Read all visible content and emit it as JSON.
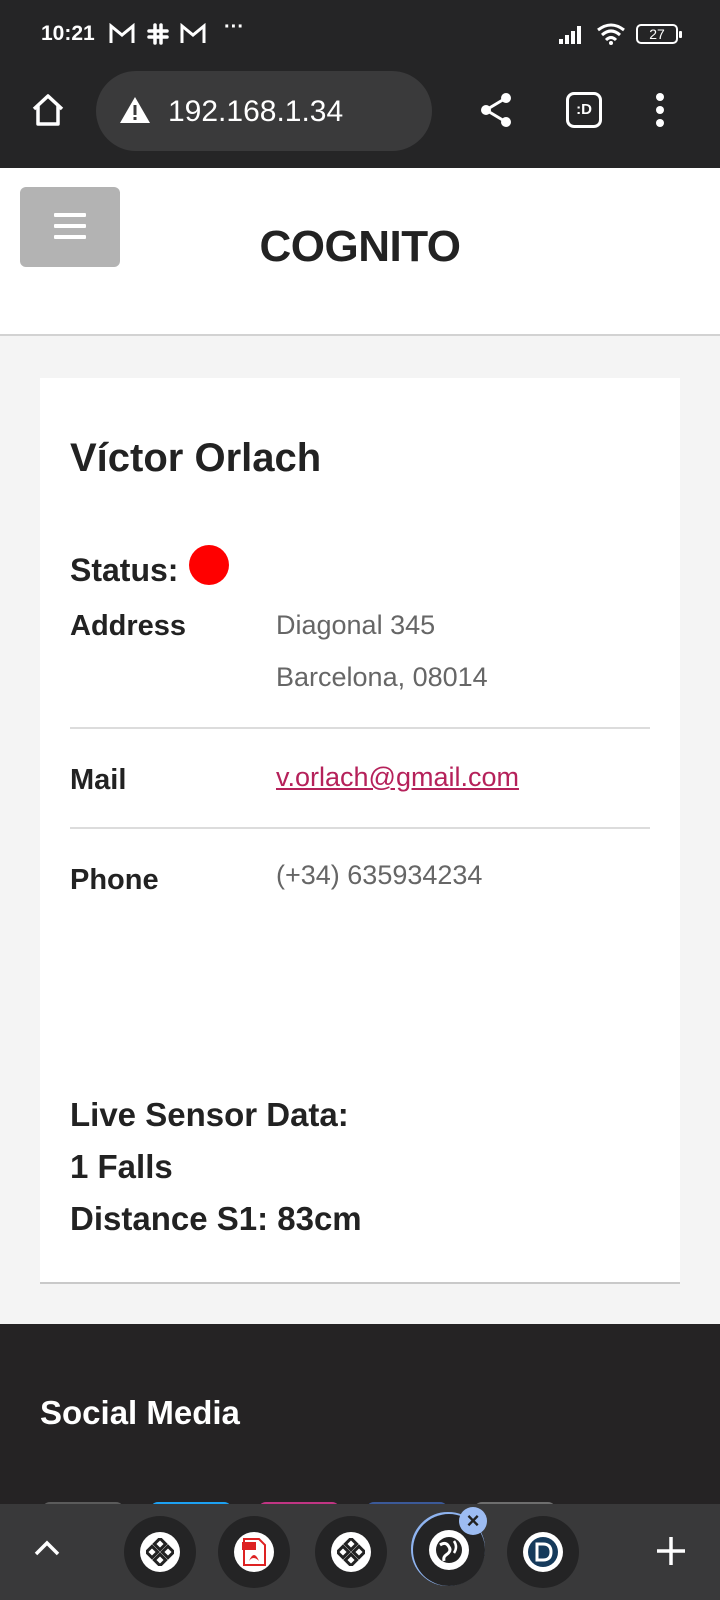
{
  "status_bar": {
    "time": "10:21",
    "notification_icons": [
      "gmail-icon",
      "slack-icon",
      "gmail-icon"
    ],
    "more": "···",
    "battery": "27"
  },
  "browser": {
    "url": "192.168.1.34",
    "security": "not-secure-warning-icon",
    "tab_count_badge": ":D"
  },
  "site": {
    "title": "COGNITO"
  },
  "profile": {
    "name": "Víctor Orlach",
    "status_label": "Status:",
    "status_color": "#ff0000",
    "address_label": "Address",
    "address_line1": "Diagonal 345",
    "address_line2": "Barcelona, 08014",
    "mail_label": "Mail",
    "mail_value": "v.orlach@gmail.com",
    "phone_label": "Phone",
    "phone_value": "(+34) 635934234"
  },
  "sensor": {
    "heading": "Live Sensor Data:",
    "falls": "1 Falls",
    "distance": "Distance S1: 83cm"
  },
  "footer": {
    "title": "Social Media",
    "social_colors": [
      "#5b5b5b",
      "#1da1f2",
      "#c13584",
      "#3b5998",
      "#6e6e6e"
    ]
  },
  "tabs": {
    "items": [
      "grid-app-icon",
      "pdf-icon",
      "grid-app-icon",
      "globe-icon",
      "d-app-icon"
    ],
    "active_index": 3
  },
  "colors": {
    "link": "#b5215a",
    "dark_bar": "#252526"
  }
}
